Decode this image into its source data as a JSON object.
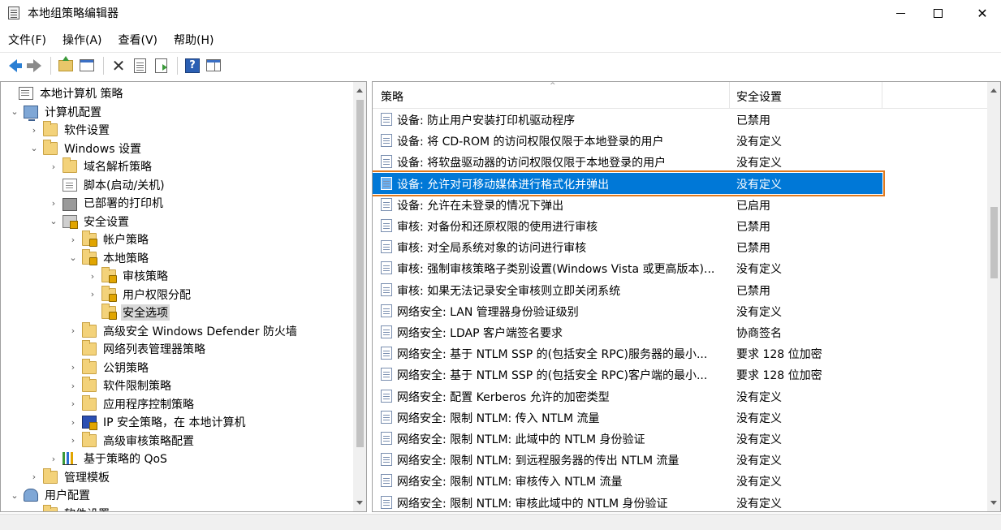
{
  "window": {
    "title": "本地组策略编辑器"
  },
  "menu": [
    "文件(F)",
    "操作(A)",
    "查看(V)",
    "帮助(H)"
  ],
  "toolbar": {
    "icons": [
      "back-icon",
      "forward-icon",
      "up-folder-icon",
      "show-hide-tree-icon",
      "delete-icon",
      "properties-icon",
      "export-list-icon",
      "help-icon",
      "show-action-pane-icon"
    ]
  },
  "tree": [
    {
      "label": "本地计算机 策略",
      "level": 0,
      "chev": "",
      "icon": "policyroot"
    },
    {
      "label": "计算机配置",
      "level": 1,
      "chev": "⌄",
      "icon": "computer"
    },
    {
      "label": "软件设置",
      "level": 2,
      "chev": "›",
      "icon": "folder"
    },
    {
      "label": "Windows 设置",
      "level": 2,
      "chev": "⌄",
      "icon": "folder"
    },
    {
      "label": "域名解析策略",
      "level": 3,
      "chev": "›",
      "icon": "folder"
    },
    {
      "label": "脚本(启动/关机)",
      "level": 3,
      "chev": "",
      "icon": "script"
    },
    {
      "label": "已部署的打印机",
      "level": 3,
      "chev": "›",
      "icon": "printer"
    },
    {
      "label": "安全设置",
      "level": 3,
      "chev": "⌄",
      "icon": "shield"
    },
    {
      "label": "帐户策略",
      "level": 4,
      "chev": "›",
      "icon": "lockfolder"
    },
    {
      "label": "本地策略",
      "level": 4,
      "chev": "⌄",
      "icon": "lockfolder"
    },
    {
      "label": "审核策略",
      "level": 5,
      "chev": "›",
      "icon": "lockfolder"
    },
    {
      "label": "用户权限分配",
      "level": 5,
      "chev": "›",
      "icon": "lockfolder"
    },
    {
      "label": "安全选项",
      "level": 5,
      "chev": "",
      "icon": "lockfolder",
      "selected": true
    },
    {
      "label": "高级安全 Windows Defender 防火墙",
      "level": 4,
      "chev": "›",
      "icon": "folder"
    },
    {
      "label": "网络列表管理器策略",
      "level": 4,
      "chev": "",
      "icon": "folder"
    },
    {
      "label": "公钥策略",
      "level": 4,
      "chev": "›",
      "icon": "folder"
    },
    {
      "label": "软件限制策略",
      "level": 4,
      "chev": "›",
      "icon": "folder"
    },
    {
      "label": "应用程序控制策略",
      "level": 4,
      "chev": "›",
      "icon": "folder"
    },
    {
      "label": "IP 安全策略，在 本地计算机",
      "level": 4,
      "chev": "›",
      "icon": "ipsec"
    },
    {
      "label": "高级审核策略配置",
      "level": 4,
      "chev": "›",
      "icon": "folder"
    },
    {
      "label": "基于策略的 QoS",
      "level": 3,
      "chev": "›",
      "icon": "qos"
    },
    {
      "label": "管理模板",
      "level": 2,
      "chev": "›",
      "icon": "folder"
    },
    {
      "label": "用户配置",
      "level": 1,
      "chev": "⌄",
      "icon": "users"
    },
    {
      "label": "软件设置",
      "level": 2,
      "chev": "›",
      "icon": "folder"
    }
  ],
  "list": {
    "columns": {
      "policy": "策略",
      "setting": "安全设置"
    },
    "rows": [
      {
        "name": "设备: 防止用户安装打印机驱动程序",
        "value": "已禁用"
      },
      {
        "name": "设备: 将 CD-ROM 的访问权限仅限于本地登录的用户",
        "value": "没有定义"
      },
      {
        "name": "设备: 将软盘驱动器的访问权限仅限于本地登录的用户",
        "value": "没有定义"
      },
      {
        "name": "设备: 允许对可移动媒体进行格式化并弹出",
        "value": "没有定义",
        "selected": true
      },
      {
        "name": "设备: 允许在未登录的情况下弹出",
        "value": "已启用"
      },
      {
        "name": "审核: 对备份和还原权限的使用进行审核",
        "value": "已禁用"
      },
      {
        "name": "审核: 对全局系统对象的访问进行审核",
        "value": "已禁用"
      },
      {
        "name": "审核: 强制审核策略子类别设置(Windows Vista 或更高版本)...",
        "value": "没有定义"
      },
      {
        "name": "审核: 如果无法记录安全审核则立即关闭系统",
        "value": "已禁用"
      },
      {
        "name": "网络安全: LAN 管理器身份验证级别",
        "value": "没有定义"
      },
      {
        "name": "网络安全: LDAP 客户端签名要求",
        "value": "协商签名"
      },
      {
        "name": "网络安全: 基于 NTLM SSP 的(包括安全 RPC)服务器的最小...",
        "value": "要求 128 位加密"
      },
      {
        "name": "网络安全: 基于 NTLM SSP 的(包括安全 RPC)客户端的最小...",
        "value": "要求 128 位加密"
      },
      {
        "name": "网络安全: 配置 Kerberos 允许的加密类型",
        "value": "没有定义"
      },
      {
        "name": "网络安全: 限制 NTLM: 传入 NTLM 流量",
        "value": "没有定义"
      },
      {
        "name": "网络安全: 限制 NTLM: 此域中的 NTLM 身份验证",
        "value": "没有定义"
      },
      {
        "name": "网络安全: 限制 NTLM: 到远程服务器的传出 NTLM 流量",
        "value": "没有定义"
      },
      {
        "name": "网络安全: 限制 NTLM: 审核传入 NTLM 流量",
        "value": "没有定义"
      },
      {
        "name": "网络安全: 限制 NTLM: 审核此域中的 NTLM 身份验证",
        "value": "没有定义"
      }
    ]
  },
  "colors": {
    "selection": "#0078d7",
    "highlight_border": "#e07a1f"
  }
}
